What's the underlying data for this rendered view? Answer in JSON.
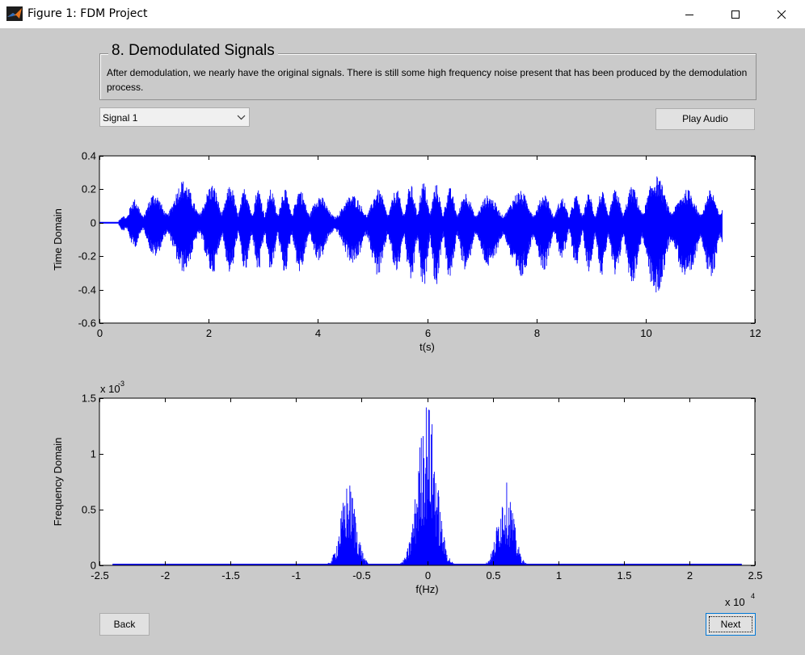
{
  "window": {
    "title": "Figure 1: FDM Project",
    "controls": [
      "minimize-icon",
      "maximize-icon",
      "close-icon"
    ]
  },
  "panel": {
    "title": "8. Demodulated Signals",
    "description": "After demodulation, we nearly have the original signals. There is still some high frequency noise present that has been produced by the demodulation process."
  },
  "signal_select": {
    "value": "Signal 1"
  },
  "buttons": {
    "play": "Play Audio",
    "back": "Back",
    "next": "Next"
  },
  "colors": {
    "trace": "#0000ff",
    "background": "#cacaca",
    "axes_bg": "#ffffff"
  },
  "chart_data": [
    {
      "type": "line",
      "ylabel": "Time Domain",
      "xlabel": "t(s)",
      "xlim": [
        0,
        12
      ],
      "ylim": [
        -0.6,
        0.4
      ],
      "xticks": [
        0,
        2,
        4,
        6,
        8,
        10,
        12
      ],
      "yticks": [
        -0.6,
        -0.4,
        -0.2,
        0,
        0.2,
        0.4
      ],
      "xtick_labels": [
        "0",
        "2",
        "4",
        "6",
        "8",
        "10",
        "12"
      ],
      "ytick_labels": [
        "-0.6",
        "-0.4",
        "-0.2",
        "0",
        "0.2",
        "0.4"
      ],
      "signal_extent_s": [
        0,
        11.4
      ],
      "envelope": {
        "t": [
          0.0,
          0.35,
          0.5,
          0.8,
          1.2,
          1.5,
          1.8,
          2.2,
          2.5,
          3.2,
          3.5,
          3.9,
          4.2,
          5.0,
          5.4,
          5.9,
          6.2,
          7.0,
          7.4,
          7.9,
          8.4,
          9.0,
          9.4,
          9.8,
          10.3,
          10.7,
          11.4
        ],
        "max": [
          0.0,
          0.0,
          0.13,
          0.16,
          0.2,
          0.26,
          0.22,
          0.24,
          0.22,
          0.2,
          0.21,
          0.2,
          0.13,
          0.2,
          0.2,
          0.25,
          0.23,
          0.16,
          0.18,
          0.2,
          0.15,
          0.18,
          0.2,
          0.22,
          0.3,
          0.2,
          0.2
        ],
        "min": [
          0.0,
          0.0,
          -0.14,
          -0.16,
          -0.25,
          -0.3,
          -0.27,
          -0.33,
          -0.3,
          -0.3,
          -0.31,
          -0.29,
          -0.15,
          -0.33,
          -0.3,
          -0.42,
          -0.38,
          -0.25,
          -0.32,
          -0.36,
          -0.21,
          -0.3,
          -0.34,
          -0.37,
          -0.46,
          -0.36,
          -0.35
        ]
      }
    },
    {
      "type": "line",
      "ylabel": "Frequency Domain",
      "xlabel": "f(Hz)",
      "xlim": [
        -25000,
        25000
      ],
      "ylim": [
        0,
        0.0015
      ],
      "xticks": [
        -25000,
        -20000,
        -15000,
        -10000,
        -5000,
        0,
        5000,
        10000,
        15000,
        20000,
        25000
      ],
      "yticks": [
        0,
        0.0005,
        0.001,
        0.0015
      ],
      "xtick_labels": [
        "-2.5",
        "-2",
        "-1.5",
        "-1",
        "-0.5",
        "0",
        "0.5",
        "1",
        "1.5",
        "2",
        "2.5"
      ],
      "ytick_labels": [
        "0",
        "0.5",
        "1",
        "1.5"
      ],
      "x_multiplier": "x 10",
      "x_multiplier_exp": "4",
      "y_multiplier": "x 10",
      "y_multiplier_exp": "-3",
      "signal_extent_hz": [
        -24000,
        24000
      ],
      "peaks": [
        {
          "center_hz": -6000,
          "halfwidth_hz": 1900,
          "peak": 0.00075
        },
        {
          "center_hz": 0,
          "halfwidth_hz": 2300,
          "peak": 0.0015
        },
        {
          "center_hz": 6000,
          "halfwidth_hz": 1900,
          "peak": 0.00075
        }
      ]
    }
  ]
}
